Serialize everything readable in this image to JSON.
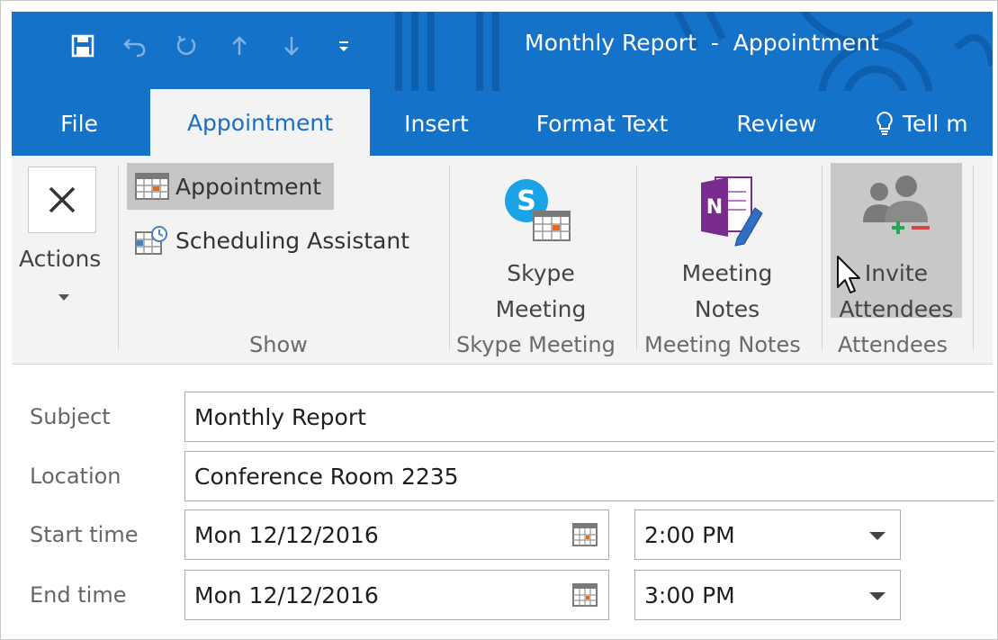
{
  "window": {
    "title": "Monthly Report  -  Appointment"
  },
  "quick_access": [
    {
      "icon": "save-icon"
    },
    {
      "icon": "undo-icon"
    },
    {
      "icon": "redo-icon"
    },
    {
      "icon": "arrow-up-icon"
    },
    {
      "icon": "arrow-down-icon"
    },
    {
      "icon": "customize-qat-icon"
    }
  ],
  "tabs": {
    "file": "File",
    "appointment": "Appointment",
    "insert": "Insert",
    "format_text": "Format Text",
    "review": "Review",
    "tell_me": "Tell m"
  },
  "ribbon": {
    "actions": {
      "label": "Actions"
    },
    "show": {
      "group_label": "Show",
      "appointment": "Appointment",
      "scheduling_assistant": "Scheduling Assistant"
    },
    "skype": {
      "group_label": "Skype Meeting",
      "line1": "Skype",
      "line2": "Meeting"
    },
    "notes": {
      "group_label": "Meeting Notes",
      "line1": "Meeting",
      "line2": "Notes"
    },
    "attendees": {
      "group_label": "Attendees",
      "line1": "Invite",
      "line2": "Attendees"
    }
  },
  "form": {
    "subject": {
      "label": "Subject",
      "value": "Monthly Report"
    },
    "location": {
      "label": "Location",
      "value": "Conference Room 2235"
    },
    "start": {
      "label": "Start time",
      "date": "Mon 12/12/2016",
      "time": "2:00 PM"
    },
    "end": {
      "label": "End time",
      "date": "Mon 12/12/2016",
      "time": "3:00 PM"
    }
  },
  "colors": {
    "titlebar": "#1572c9",
    "ribbon_bg": "#f3f3f3",
    "active_tab_text": "#1a6ec3",
    "onenote_purple": "#7a2b8e",
    "skype_blue": "#1aa3e6",
    "calendar_orange": "#e36b1d"
  }
}
